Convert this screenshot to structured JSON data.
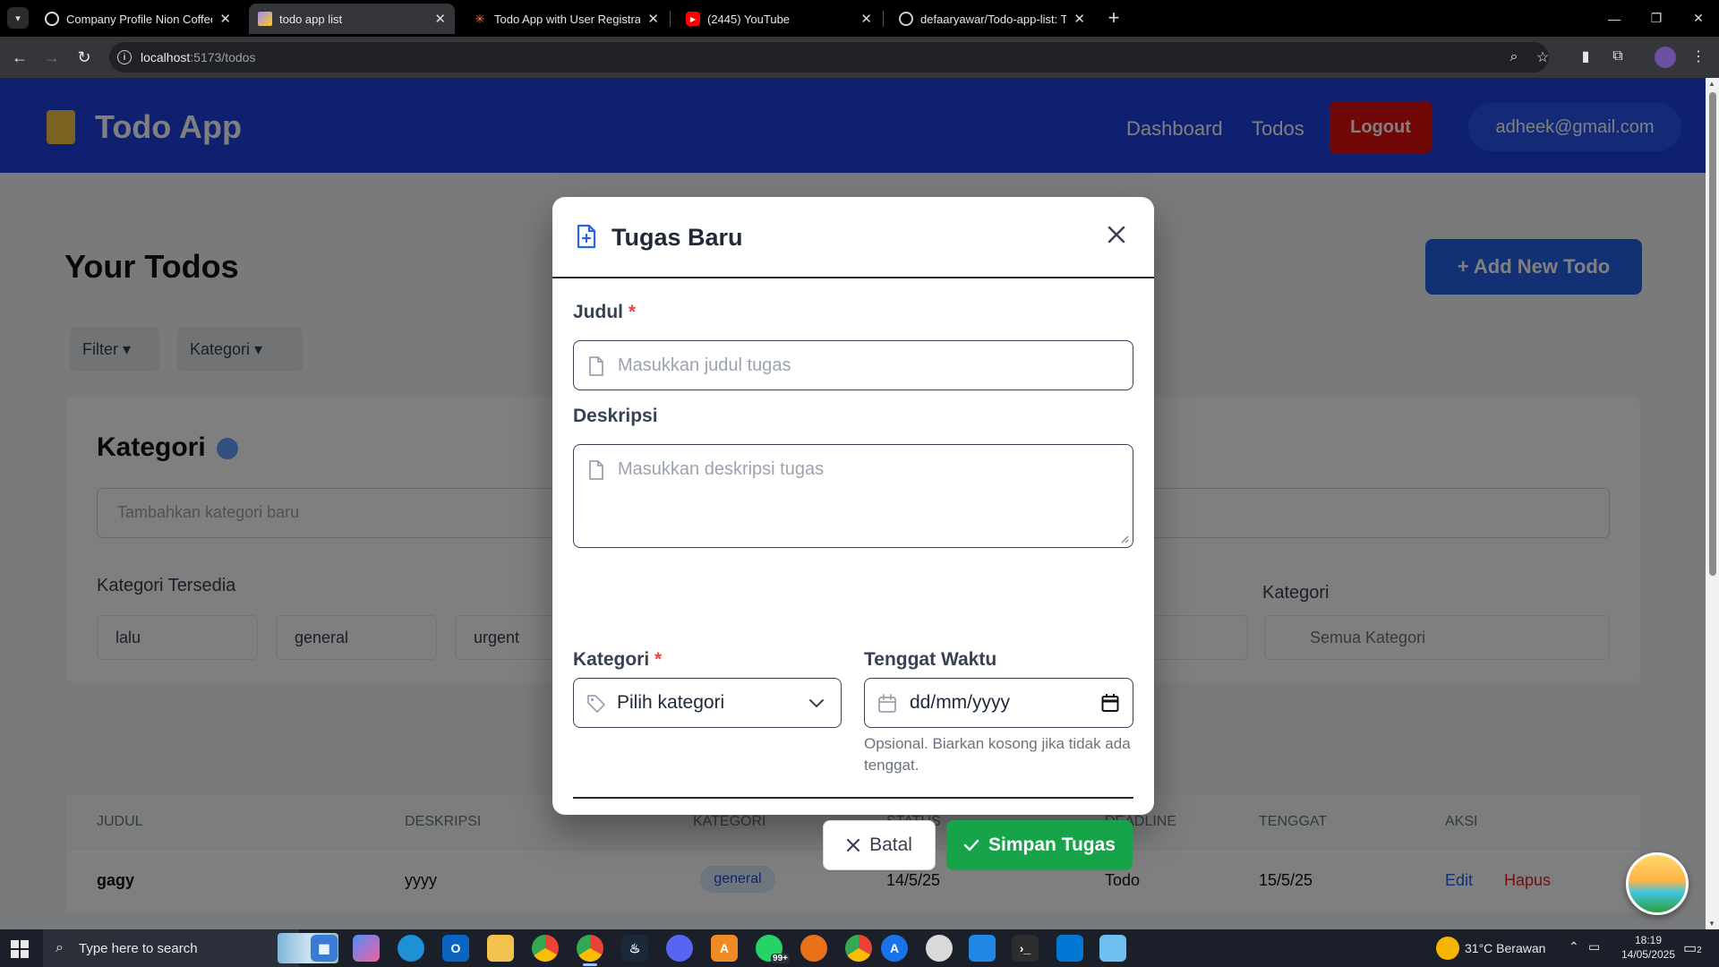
{
  "browser": {
    "tabs": [
      {
        "title": "Company Profile Nion Coffee",
        "active": false
      },
      {
        "title": "todo app list",
        "active": true
      },
      {
        "title": "Todo App with User Registratio",
        "active": false
      },
      {
        "title": "(2445) YouTube",
        "active": false
      },
      {
        "title": "defaaryawar/Todo-app-list: Tes",
        "active": false
      }
    ],
    "url_host": "localhost",
    "url_path": ":5173/todos"
  },
  "app": {
    "title": "Todo App",
    "nav": [
      "Dashboard",
      "Todos"
    ],
    "logout_label": "Logout",
    "user_email": "adheek@gmail.com",
    "page_title": "Your Todos",
    "add_button": "+ Add New Todo",
    "filters": [
      "Filter ▾",
      "Kategori ▾"
    ],
    "category_card": {
      "title": "Kategori",
      "input_placeholder": "Tambahkan kategori baru",
      "available_label": "Kategori Tersedia",
      "chips": [
        "lalu",
        "general",
        "urgent"
      ],
      "select_label": "Kategori",
      "select_value": "Semua Kategori"
    },
    "table": {
      "headers": [
        "Judul",
        "Deskripsi",
        "Kategori",
        "Status",
        "Deadline",
        "Tenggat",
        "Aksi"
      ],
      "row": {
        "title": "gagy",
        "desc": "yyyy",
        "category": "general",
        "date": "14/5/25",
        "status": "Todo",
        "deadline": "15/5/25",
        "edit": "Edit",
        "delete": "Hapus"
      }
    }
  },
  "modal": {
    "title": "Tugas Baru",
    "judul_label": "Judul",
    "required_mark": "*",
    "judul_placeholder": "Masukkan judul tugas",
    "deskripsi_label": "Deskripsi",
    "deskripsi_placeholder": "Masukkan deskripsi tugas",
    "kategori_label": "Kategori",
    "kategori_value": "Pilih kategori",
    "tenggat_label": "Tenggat Waktu",
    "tenggat_value": "dd/mm/yyyy",
    "tenggat_hint": "Opsional. Biarkan kosong jika tidak ada tenggat.",
    "cancel_label": "Batal",
    "save_label": "Simpan Tugas"
  },
  "taskbar": {
    "search_placeholder": "Type here to search",
    "weather": "31°C  Berawan",
    "time": "18:19",
    "date": "14/05/2025",
    "notif_count": "2",
    "whatsapp_badge": "99+"
  },
  "colors": {
    "accent": "#1e40e0",
    "save": "#16a34a",
    "required": "#ef4444"
  }
}
